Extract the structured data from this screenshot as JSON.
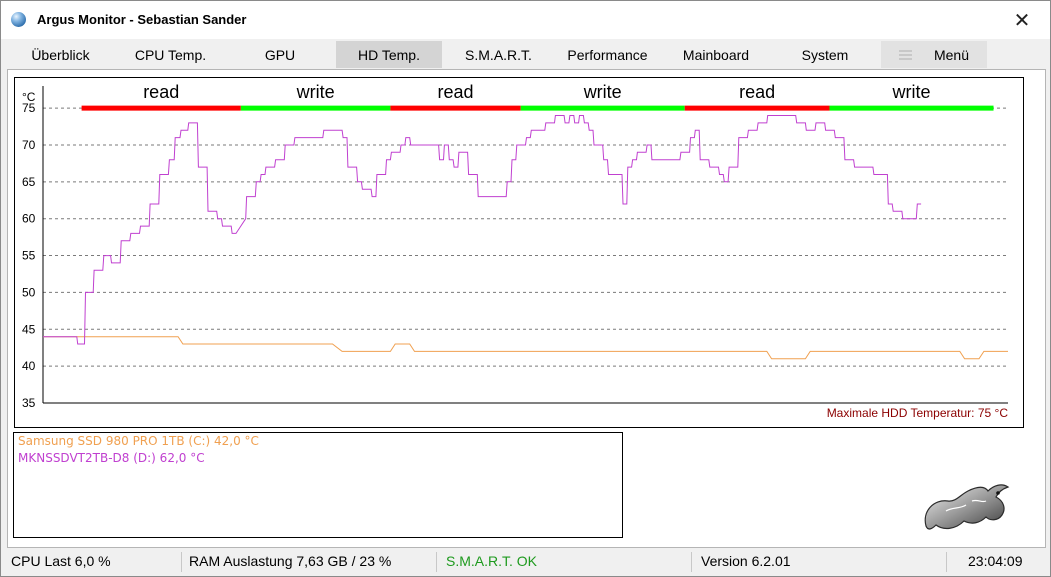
{
  "window": {
    "title": "Argus Monitor - Sebastian Sander",
    "close_glyph": "✕",
    "icon": "argus-app-icon"
  },
  "tabs": [
    {
      "label": "Überblick",
      "active": false
    },
    {
      "label": "CPU Temp.",
      "active": false
    },
    {
      "label": "GPU",
      "active": false
    },
    {
      "label": "HD Temp.",
      "active": true
    },
    {
      "label": "S.M.A.R.T.",
      "active": false
    },
    {
      "label": "Performance",
      "active": false
    },
    {
      "label": "Mainboard",
      "active": false
    },
    {
      "label": "System",
      "active": false
    },
    {
      "label": "Menü",
      "active": false,
      "icon": "hamburger-icon"
    }
  ],
  "chart_data": {
    "type": "line",
    "ylabel": "°C",
    "ylim": [
      35,
      78
    ],
    "yticks": [
      35,
      40,
      45,
      50,
      55,
      60,
      65,
      70,
      75
    ],
    "grid": true,
    "threshold": {
      "value": 75,
      "label": "Maximale HDD Temperatur: 75 °C",
      "color": "#8b0000"
    },
    "annotations": [
      {
        "label": "read",
        "color": "#ff0000",
        "x_start": 0.04,
        "x_end": 0.205
      },
      {
        "label": "write",
        "color": "#00ff00",
        "x_start": 0.205,
        "x_end": 0.36
      },
      {
        "label": "read",
        "color": "#ff0000",
        "x_start": 0.36,
        "x_end": 0.495
      },
      {
        "label": "write",
        "color": "#00ff00",
        "x_start": 0.495,
        "x_end": 0.665
      },
      {
        "label": "read",
        "color": "#ff0000",
        "x_start": 0.665,
        "x_end": 0.815
      },
      {
        "label": "write",
        "color": "#00ff00",
        "x_start": 0.815,
        "x_end": 0.985
      }
    ],
    "series": [
      {
        "name": "Samsung SSD 980 PRO 1TB (C:)",
        "color": "#f0a050",
        "points": [
          [
            0.0,
            44
          ],
          [
            0.035,
            44
          ],
          [
            0.04,
            44
          ],
          [
            0.05,
            44
          ],
          [
            0.06,
            44
          ],
          [
            0.14,
            44
          ],
          [
            0.145,
            43
          ],
          [
            0.2,
            43
          ],
          [
            0.3,
            43
          ],
          [
            0.31,
            42
          ],
          [
            0.35,
            42
          ],
          [
            0.36,
            42
          ],
          [
            0.365,
            43
          ],
          [
            0.38,
            43
          ],
          [
            0.385,
            42
          ],
          [
            0.5,
            42
          ],
          [
            0.6,
            42
          ],
          [
            0.7,
            42
          ],
          [
            0.75,
            42
          ],
          [
            0.755,
            41
          ],
          [
            0.79,
            41
          ],
          [
            0.795,
            42
          ],
          [
            0.9,
            42
          ],
          [
            0.95,
            42
          ],
          [
            0.955,
            41
          ],
          [
            0.97,
            41
          ],
          [
            0.975,
            42
          ],
          [
            1.0,
            42
          ]
        ]
      },
      {
        "name": "MKNSSDVT2TB-D8 (D:)",
        "color": "#c040d0",
        "points": [
          [
            0.0,
            44
          ],
          [
            0.035,
            44
          ],
          [
            0.036,
            43
          ],
          [
            0.043,
            43
          ],
          [
            0.044,
            50
          ],
          [
            0.052,
            50
          ],
          [
            0.053,
            53
          ],
          [
            0.062,
            53
          ],
          [
            0.063,
            55
          ],
          [
            0.07,
            55
          ],
          [
            0.071,
            54
          ],
          [
            0.08,
            54
          ],
          [
            0.081,
            57
          ],
          [
            0.09,
            57
          ],
          [
            0.091,
            58
          ],
          [
            0.1,
            58
          ],
          [
            0.101,
            59
          ],
          [
            0.11,
            59
          ],
          [
            0.111,
            62
          ],
          [
            0.12,
            62
          ],
          [
            0.121,
            66
          ],
          [
            0.13,
            66
          ],
          [
            0.131,
            68
          ],
          [
            0.136,
            68
          ],
          [
            0.137,
            71
          ],
          [
            0.142,
            71
          ],
          [
            0.143,
            72
          ],
          [
            0.15,
            72
          ],
          [
            0.151,
            73
          ],
          [
            0.16,
            73
          ],
          [
            0.161,
            67
          ],
          [
            0.17,
            67
          ],
          [
            0.171,
            61
          ],
          [
            0.18,
            61
          ],
          [
            0.181,
            60
          ],
          [
            0.185,
            60
          ],
          [
            0.186,
            59
          ],
          [
            0.195,
            59
          ],
          [
            0.196,
            58
          ],
          [
            0.2,
            58
          ],
          [
            0.205,
            59
          ],
          [
            0.21,
            60
          ],
          [
            0.211,
            63
          ],
          [
            0.22,
            63
          ],
          [
            0.221,
            65
          ],
          [
            0.225,
            65
          ],
          [
            0.226,
            66
          ],
          [
            0.23,
            66
          ],
          [
            0.231,
            67
          ],
          [
            0.24,
            67
          ],
          [
            0.241,
            68
          ],
          [
            0.25,
            68
          ],
          [
            0.251,
            70
          ],
          [
            0.26,
            70
          ],
          [
            0.261,
            71
          ],
          [
            0.29,
            71
          ],
          [
            0.291,
            72
          ],
          [
            0.31,
            72
          ],
          [
            0.311,
            71
          ],
          [
            0.315,
            71
          ],
          [
            0.316,
            67
          ],
          [
            0.325,
            67
          ],
          [
            0.326,
            65
          ],
          [
            0.33,
            65
          ],
          [
            0.331,
            64
          ],
          [
            0.34,
            64
          ],
          [
            0.341,
            63
          ],
          [
            0.345,
            63
          ],
          [
            0.346,
            66
          ],
          [
            0.355,
            66
          ],
          [
            0.356,
            68
          ],
          [
            0.36,
            68
          ],
          [
            0.361,
            69
          ],
          [
            0.37,
            69
          ],
          [
            0.371,
            70
          ],
          [
            0.375,
            70
          ],
          [
            0.376,
            71
          ],
          [
            0.38,
            71
          ],
          [
            0.381,
            70
          ],
          [
            0.4,
            70
          ],
          [
            0.41,
            70
          ],
          [
            0.411,
            68
          ],
          [
            0.415,
            68
          ],
          [
            0.416,
            70
          ],
          [
            0.42,
            70
          ],
          [
            0.421,
            68
          ],
          [
            0.425,
            68
          ],
          [
            0.426,
            67
          ],
          [
            0.43,
            67
          ],
          [
            0.431,
            69
          ],
          [
            0.44,
            69
          ],
          [
            0.441,
            66
          ],
          [
            0.45,
            66
          ],
          [
            0.451,
            63
          ],
          [
            0.48,
            63
          ],
          [
            0.481,
            65
          ],
          [
            0.485,
            65
          ],
          [
            0.486,
            68
          ],
          [
            0.49,
            68
          ],
          [
            0.491,
            70
          ],
          [
            0.5,
            70
          ],
          [
            0.501,
            71
          ],
          [
            0.505,
            71
          ],
          [
            0.506,
            72
          ],
          [
            0.52,
            72
          ],
          [
            0.521,
            73
          ],
          [
            0.53,
            73
          ],
          [
            0.531,
            74
          ],
          [
            0.54,
            74
          ],
          [
            0.541,
            73
          ],
          [
            0.545,
            73
          ],
          [
            0.546,
            74
          ],
          [
            0.55,
            74
          ],
          [
            0.551,
            73
          ],
          [
            0.555,
            73
          ],
          [
            0.556,
            74
          ],
          [
            0.56,
            74
          ],
          [
            0.561,
            73
          ],
          [
            0.565,
            73
          ],
          [
            0.566,
            72
          ],
          [
            0.57,
            72
          ],
          [
            0.571,
            70
          ],
          [
            0.58,
            70
          ],
          [
            0.581,
            68
          ],
          [
            0.585,
            68
          ],
          [
            0.586,
            66
          ],
          [
            0.6,
            66
          ],
          [
            0.601,
            62
          ],
          [
            0.605,
            62
          ],
          [
            0.606,
            67
          ],
          [
            0.61,
            67
          ],
          [
            0.611,
            68
          ],
          [
            0.615,
            68
          ],
          [
            0.616,
            69
          ],
          [
            0.625,
            69
          ],
          [
            0.626,
            70
          ],
          [
            0.63,
            70
          ],
          [
            0.631,
            68
          ],
          [
            0.66,
            68
          ],
          [
            0.661,
            69
          ],
          [
            0.67,
            69
          ],
          [
            0.671,
            71
          ],
          [
            0.675,
            71
          ],
          [
            0.676,
            72
          ],
          [
            0.68,
            72
          ],
          [
            0.681,
            68
          ],
          [
            0.69,
            68
          ],
          [
            0.691,
            67
          ],
          [
            0.7,
            67
          ],
          [
            0.701,
            66
          ],
          [
            0.705,
            66
          ],
          [
            0.706,
            65
          ],
          [
            0.71,
            65
          ],
          [
            0.711,
            67
          ],
          [
            0.72,
            67
          ],
          [
            0.721,
            71
          ],
          [
            0.73,
            71
          ],
          [
            0.731,
            72
          ],
          [
            0.74,
            72
          ],
          [
            0.741,
            73
          ],
          [
            0.75,
            73
          ],
          [
            0.751,
            74
          ],
          [
            0.78,
            74
          ],
          [
            0.781,
            73
          ],
          [
            0.79,
            73
          ],
          [
            0.791,
            72
          ],
          [
            0.8,
            72
          ],
          [
            0.801,
            73
          ],
          [
            0.81,
            73
          ],
          [
            0.811,
            72
          ],
          [
            0.82,
            72
          ],
          [
            0.821,
            71
          ],
          [
            0.83,
            71
          ],
          [
            0.831,
            68
          ],
          [
            0.84,
            68
          ],
          [
            0.841,
            67
          ],
          [
            0.86,
            67
          ],
          [
            0.861,
            66
          ],
          [
            0.875,
            66
          ],
          [
            0.876,
            62
          ],
          [
            0.88,
            62
          ],
          [
            0.881,
            61
          ],
          [
            0.89,
            61
          ],
          [
            0.891,
            60
          ],
          [
            0.9,
            60
          ],
          [
            0.905,
            60
          ],
          [
            0.906,
            62
          ],
          [
            0.91,
            62
          ]
        ]
      }
    ]
  },
  "legend": [
    {
      "label": "Samsung SSD 980 PRO 1TB (C:) 42,0 °C",
      "color": "#f0a050"
    },
    {
      "label": "MKNSSDVT2TB-D8 (D:) 62,0 °C",
      "color": "#c040d0"
    }
  ],
  "status": {
    "cpu": "CPU Last 6,0 %",
    "ram": "RAM Auslastung 7,63 GB / 23 %",
    "smart": "S.M.A.R.T. OK",
    "smart_color": "#1e9a1e",
    "version": "Version 6.2.01",
    "time": "23:04:09"
  },
  "logo": {
    "icon": "argus-salamander-logo"
  }
}
